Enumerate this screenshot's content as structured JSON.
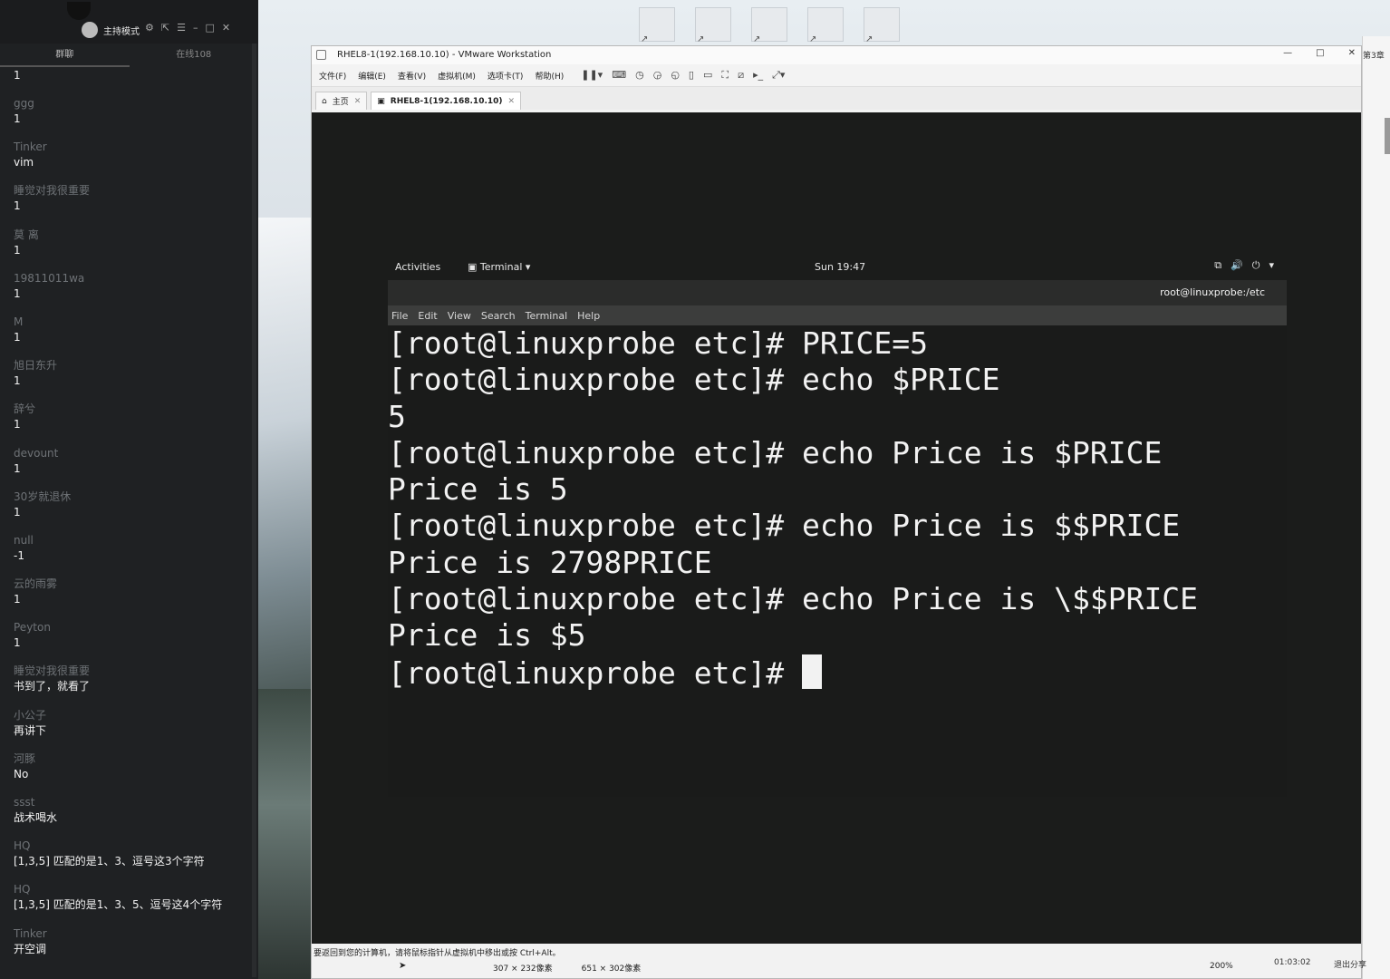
{
  "chat": {
    "host_label": "主持模式",
    "tabs": [
      "群聊",
      "在线108"
    ],
    "messages": [
      {
        "user": "",
        "text": "1"
      },
      {
        "user": "ggg",
        "text": "1"
      },
      {
        "user": "Tinker",
        "text": "vim"
      },
      {
        "user": "睡觉对我很重要",
        "text": "1"
      },
      {
        "user": "莫 离",
        "text": "1"
      },
      {
        "user": "19811011wa",
        "text": "1"
      },
      {
        "user": "M",
        "text": "1"
      },
      {
        "user": "旭日东升",
        "text": "1"
      },
      {
        "user": "辞兮",
        "text": "1"
      },
      {
        "user": "devount",
        "text": "1"
      },
      {
        "user": "30岁就退休",
        "text": "1"
      },
      {
        "user": "null",
        "text": "-1"
      },
      {
        "user": "云的雨雾",
        "text": "1"
      },
      {
        "user": "Peyton",
        "text": "1"
      },
      {
        "user": "睡觉对我很重要",
        "text": "书到了，就看了"
      },
      {
        "user": "小公子",
        "text": "再讲下"
      },
      {
        "user": "河豚",
        "text": "No"
      },
      {
        "user": "ssst",
        "text": "战术喝水"
      },
      {
        "user": "HQ",
        "text": "[1,3,5] 匹配的是1、3、逗号这3个字符"
      },
      {
        "user": "HQ",
        "text": "[1,3,5] 匹配的是1、3、5、逗号这4个字符"
      },
      {
        "user": "Tinker",
        "text": "开空调"
      }
    ]
  },
  "vmware": {
    "title": "RHEL8-1(192.168.10.10) - VMware Workstation",
    "window_controls": [
      "—",
      "□",
      "✕"
    ],
    "menu": [
      "文件(F)",
      "编辑(E)",
      "查看(V)",
      "虚拟机(M)",
      "选项卡(T)",
      "帮助(H)"
    ],
    "tabs": [
      {
        "label": "主页",
        "close": "✕"
      },
      {
        "label": "RHEL8-1(192.168.10.10)",
        "close": "✕"
      }
    ],
    "status_hint": "要返回到您的计算机，请将鼠标指针从虚拟机中移出或按 Ctrl+Alt。",
    "selection_size_1": "307 × 232像素",
    "selection_size_2": "651 × 302像素",
    "zoom": "200%"
  },
  "gnome": {
    "activities": "Activities",
    "terminal_menu": "Terminal ▾",
    "clock": "Sun 19:47"
  },
  "terminal": {
    "title": "root@linuxprobe:/etc",
    "menu": [
      "File",
      "Edit",
      "View",
      "Search",
      "Terminal",
      "Help"
    ],
    "lines": [
      "[root@linuxprobe etc]# PRICE=5",
      "[root@linuxprobe etc]# echo $PRICE",
      "5",
      "[root@linuxprobe etc]# echo Price is $PRICE",
      "Price is 5",
      "[root@linuxprobe etc]# echo Price is $$PRICE",
      "Price is 2798PRICE",
      "[root@linuxprobe etc]# echo Price is \\$$PRICE",
      "Price is $5"
    ],
    "prompt": "[root@linuxprobe etc]# "
  },
  "right_strip": {
    "label": "第3章",
    "time": "01:03:02",
    "exit_share": "退出分享"
  }
}
